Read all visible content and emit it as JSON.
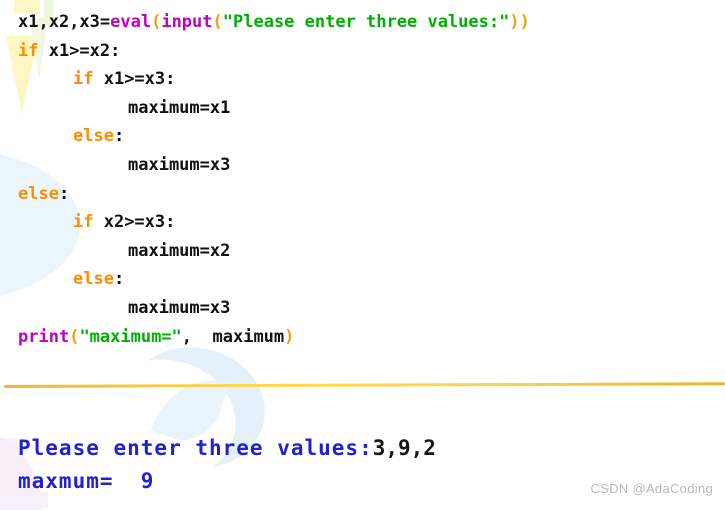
{
  "document": {
    "kind": "python-code-and-console-screenshot",
    "background_color": "#ffffff"
  },
  "colors": {
    "keyword": "#ff8c00",
    "builtin": "#c000c0",
    "paren": "#e8a317",
    "string": "#00b000",
    "plain": "#111111",
    "divider": "#ffd34d",
    "console_text": "#2222cc",
    "console_typed": "#161616",
    "watermark": "#b9b9b9"
  },
  "code": {
    "language": "Python",
    "lines": [
      {
        "indent": 0,
        "tokens": [
          {
            "t": "x1,x2,x3=",
            "c": "plain"
          },
          {
            "t": "eval",
            "c": "builtin"
          },
          {
            "t": "(",
            "c": "paren"
          },
          {
            "t": "input",
            "c": "builtin"
          },
          {
            "t": "(",
            "c": "paren"
          },
          {
            "t": "\"Please enter three values:\"",
            "c": "string"
          },
          {
            "t": ")",
            "c": "paren"
          },
          {
            "t": ")",
            "c": "paren"
          }
        ],
        "plain": "x1,x2,x3=eval(input(\"Please enter three values:\"))"
      },
      {
        "indent": 0,
        "tokens": [
          {
            "t": "if",
            "c": "keyword"
          },
          {
            "t": " x1>=x2:",
            "c": "plain"
          }
        ],
        "plain": "if x1>=x2:"
      },
      {
        "indent": 1,
        "tokens": [
          {
            "t": "if",
            "c": "keyword"
          },
          {
            "t": " x1>=x3:",
            "c": "plain"
          }
        ],
        "plain": "    if x1>=x3:"
      },
      {
        "indent": 2,
        "tokens": [
          {
            "t": "maximum=x1",
            "c": "plain"
          }
        ],
        "plain": "        maximum=x1"
      },
      {
        "indent": 1,
        "tokens": [
          {
            "t": "else",
            "c": "keyword"
          },
          {
            "t": ":",
            "c": "plain"
          }
        ],
        "plain": "    else:"
      },
      {
        "indent": 2,
        "tokens": [
          {
            "t": "maximum=x3",
            "c": "plain"
          }
        ],
        "plain": "        maximum=x3"
      },
      {
        "indent": 0,
        "tokens": [
          {
            "t": "else",
            "c": "keyword"
          },
          {
            "t": ":",
            "c": "plain"
          }
        ],
        "plain": "else:"
      },
      {
        "indent": 1,
        "tokens": [
          {
            "t": "if",
            "c": "keyword"
          },
          {
            "t": " x2>=x3:",
            "c": "plain"
          }
        ],
        "plain": "    if x2>=x3:"
      },
      {
        "indent": 2,
        "tokens": [
          {
            "t": "maximum=x2",
            "c": "plain"
          }
        ],
        "plain": "        maximum=x2"
      },
      {
        "indent": 1,
        "tokens": [
          {
            "t": "else",
            "c": "keyword"
          },
          {
            "t": ":",
            "c": "plain"
          }
        ],
        "plain": "    else:"
      },
      {
        "indent": 2,
        "tokens": [
          {
            "t": "maximum=x3",
            "c": "plain"
          }
        ],
        "plain": "        maximum=x3"
      },
      {
        "indent": 0,
        "tokens": [
          {
            "t": "print",
            "c": "builtin"
          },
          {
            "t": "(",
            "c": "paren"
          },
          {
            "t": "\"maximum=\"",
            "c": "string"
          },
          {
            "t": ",  maximum",
            "c": "plain"
          },
          {
            "t": ")",
            "c": "paren"
          }
        ],
        "plain": "print(\"maximum=\",  maximum)"
      }
    ]
  },
  "console": {
    "prompt_text": "Please enter three values:",
    "typed_input": "3,9,2",
    "result_text": "maxmum=  9"
  },
  "watermark": {
    "text": "CSDN @AdaCoding"
  }
}
